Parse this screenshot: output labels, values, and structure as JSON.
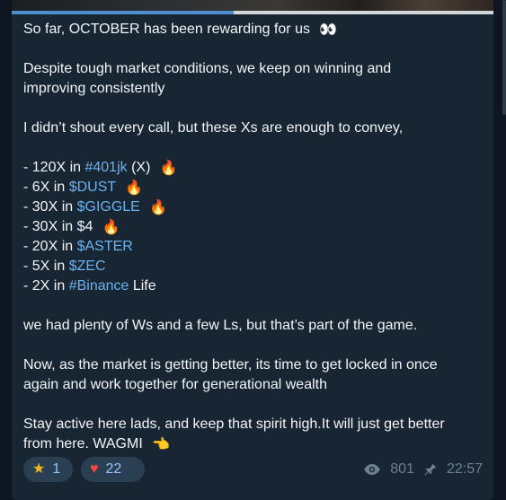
{
  "media": {
    "progress_percent": 46
  },
  "message": {
    "line1": "So far, OCTOBER has been rewarding for us",
    "line2": "Despite tough market conditions, we keep on winning and",
    "line3": "improving consistently",
    "line4": "I didn’t shout every call, but these Xs are enough to convey,",
    "items": [
      {
        "prefix": "- 120X in ",
        "tag": "#401jk",
        "suffix": " (X)"
      },
      {
        "prefix": "- 6X in ",
        "tag": "$DUST",
        "suffix": ""
      },
      {
        "prefix": "- 30X in ",
        "tag": "$GIGGLE",
        "suffix": ""
      },
      {
        "prefix": "- 30X in $4",
        "tag": "",
        "suffix": ""
      },
      {
        "prefix": "- 20X in ",
        "tag": "$ASTER",
        "suffix": ""
      },
      {
        "prefix": "- 5X in ",
        "tag": "$ZEC",
        "suffix": ""
      },
      {
        "prefix": "- 2X in ",
        "tag": "#Binance",
        "suffix": " Life"
      }
    ],
    "line5": "we had plenty of Ws and a few Ls, but that’s part of the game.",
    "line6": "Now, as the market is getting better, its time to get locked in once",
    "line7": "again and work together for generational wealth",
    "line8": "Stay active here lads, and keep that spirit high.It will just get better",
    "line9": "from here. WAGMI"
  },
  "reactions": [
    {
      "icon": "star",
      "count": "1"
    },
    {
      "icon": "heart",
      "count": "22"
    }
  ],
  "meta": {
    "views": "801",
    "time": "22:57"
  },
  "colors": {
    "background": "#0e1621",
    "bubble": "#182533",
    "link": "#6ab2f2",
    "meta": "#6d8193",
    "reaction_background": "#2b3f52"
  },
  "icons": {
    "eyes": "eyes-icon",
    "fire": "fire-icon",
    "point": "pointing-hand-icon",
    "star": "star-icon",
    "heart": "heart-icon",
    "views": "eye-icon",
    "pinned": "pin-icon"
  }
}
